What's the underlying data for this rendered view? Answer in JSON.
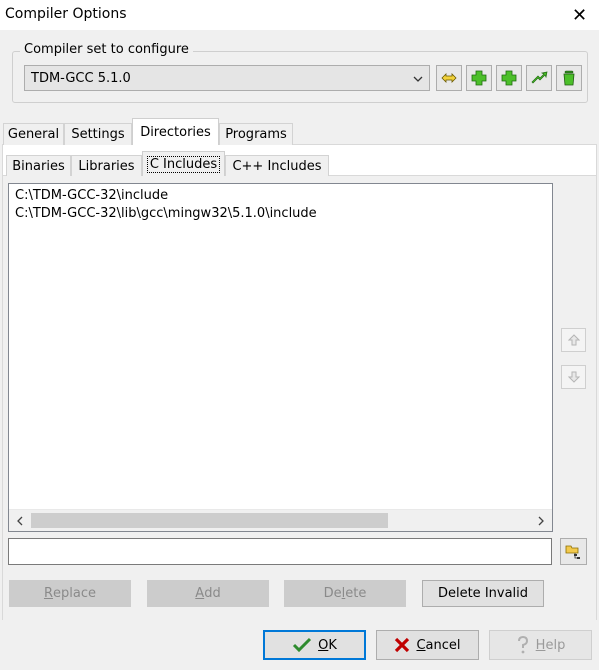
{
  "window": {
    "title": "Compiler Options",
    "close_glyph": "✕"
  },
  "compiler_set": {
    "legend": "Compiler set to configure",
    "selected": "TDM-GCC 5.1.0",
    "tools": [
      "rename-icon",
      "add-icon",
      "add-icon",
      "copy-icon",
      "trash-icon"
    ]
  },
  "tabs": [
    "General",
    "Settings",
    "Directories",
    "Programs"
  ],
  "active_tab": "Directories",
  "sub_tabs": [
    "Binaries",
    "Libraries",
    "C Includes",
    "C++ Includes"
  ],
  "active_sub_tab": "C Includes",
  "paths": [
    "C:\\TDM-GCC-32\\include",
    "C:\\TDM-GCC-32\\lib\\gcc\\mingw32\\5.1.0\\include"
  ],
  "path_input": {
    "value": ""
  },
  "actions": {
    "replace": {
      "label": "Replace",
      "mnemonic": "R",
      "rest": "eplace"
    },
    "add": {
      "label": "Add",
      "mnemonic": "A",
      "rest": "dd"
    },
    "delete": {
      "pre": "De",
      "mnemonic": "l",
      "rest": "ete"
    },
    "delete_invalid": {
      "label": "Delete Invalid"
    }
  },
  "dialog": {
    "ok": {
      "mnemonic": "O",
      "rest": "K"
    },
    "cancel": {
      "mnemonic": "C",
      "rest": "ancel"
    },
    "help": {
      "mnemonic": "H",
      "rest": "elp"
    }
  },
  "colors": {
    "accent": "#0078d7",
    "ok_green": "#2e8b2e",
    "cancel_red": "#c00000"
  }
}
